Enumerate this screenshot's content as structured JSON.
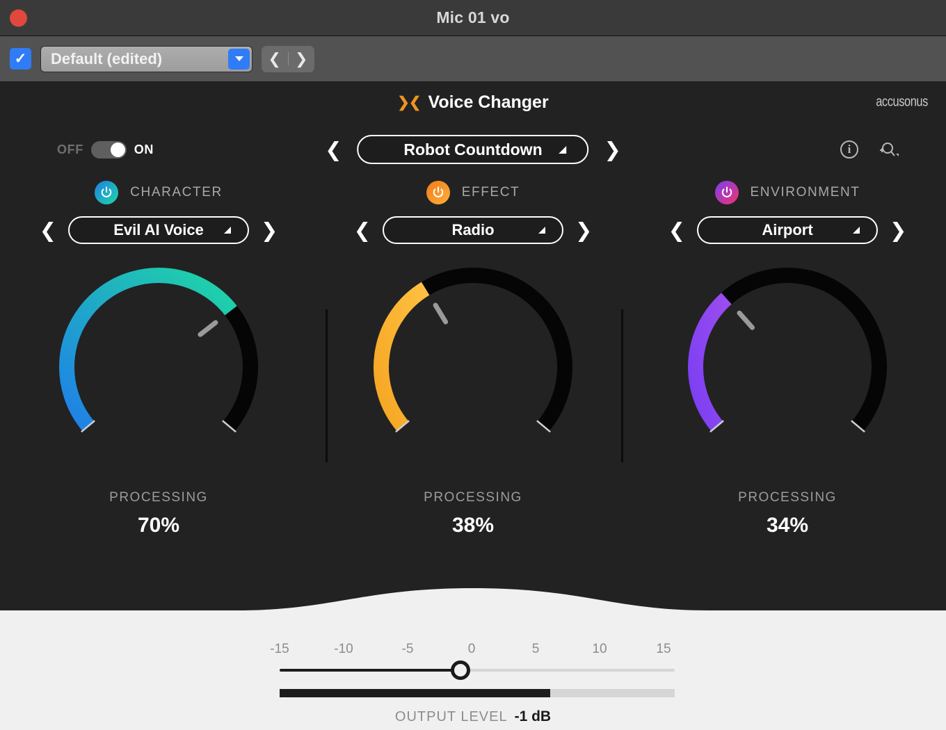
{
  "window": {
    "title": "Mic 01 vo",
    "close_icon": "close-traffic-light"
  },
  "toolbar": {
    "bypass_checked": true,
    "check_glyph": "✓",
    "preset_name": "Default (edited)",
    "prev_glyph": "❮",
    "next_glyph": "❯"
  },
  "header": {
    "brand_mark": "❯❮",
    "title": "Voice Changer",
    "company": "accusonus"
  },
  "power": {
    "off_label": "OFF",
    "on_label": "ON",
    "state": "on"
  },
  "preset_browser": {
    "prev_glyph": "❮",
    "next_glyph": "❯",
    "current": "Robot Countdown"
  },
  "top_icons": {
    "info_glyph": "i",
    "info_name": "info-icon",
    "zoom_name": "zoom-magnifier-icon"
  },
  "modules": [
    {
      "name": "CHARACTER",
      "selection": "Evil AI Voice",
      "processing_label": "PROCESSING",
      "processing_value": "70%",
      "percent": 70,
      "color_start": "#1f7fe8",
      "color_end": "#1fd6a5",
      "prev_glyph": "❮",
      "next_glyph": "❯",
      "enabled": true
    },
    {
      "name": "EFFECT",
      "selection": "Radio",
      "processing_label": "PROCESSING",
      "processing_value": "38%",
      "percent": 38,
      "color_start": "#f5a623",
      "color_end": "#ffc042",
      "prev_glyph": "❮",
      "next_glyph": "❯",
      "enabled": true
    },
    {
      "name": "ENVIRONMENT",
      "selection": "Airport",
      "processing_label": "PROCESSING",
      "processing_value": "34%",
      "percent": 34,
      "color_start": "#7b3ff2",
      "color_end": "#9b4df0",
      "prev_glyph": "❮",
      "next_glyph": "❯",
      "enabled": true
    }
  ],
  "output": {
    "ticks": [
      "-15",
      "-10",
      "-5",
      "0",
      "5",
      "10",
      "15"
    ],
    "min": -15,
    "max": 15,
    "value": -1,
    "slider_percent": 46.7,
    "meter_percent": 70,
    "label": "OUTPUT LEVEL",
    "value_text": "-1 dB"
  }
}
